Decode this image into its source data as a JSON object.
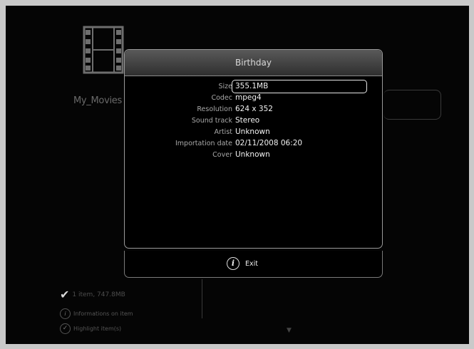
{
  "background": {
    "folder_label": "My_Movies",
    "status_items": "1 item, 747.8MB",
    "info_hint": "Informations on item",
    "highlight_hint": "Highlight item(s)"
  },
  "dialog": {
    "title": "Birthday",
    "rows": [
      {
        "label": "Size",
        "value": "355.1MB"
      },
      {
        "label": "Codec",
        "value": "mpeg4"
      },
      {
        "label": "Resolution",
        "value": "624 x 352"
      },
      {
        "label": "Sound track",
        "value": "Stereo"
      },
      {
        "label": "Artist",
        "value": "Unknown"
      },
      {
        "label": "Importation date",
        "value": "02/11/2008 06:20"
      },
      {
        "label": "Cover",
        "value": "Unknown"
      }
    ],
    "exit_label": "Exit",
    "exit_icon_glyph": "i"
  },
  "colors": {
    "screen_bg": "#050505",
    "dialog_border": "#9a9a9a",
    "header_gradient_top": "#595959",
    "text_primary": "#f2f2f2",
    "text_label": "#a8a8a8"
  },
  "icons": {
    "folder": "film-strip-icon",
    "check": "checkmark-icon",
    "info": "info-icon",
    "highlight": "circle-check-icon",
    "scroll": "down-arrow-icon"
  }
}
